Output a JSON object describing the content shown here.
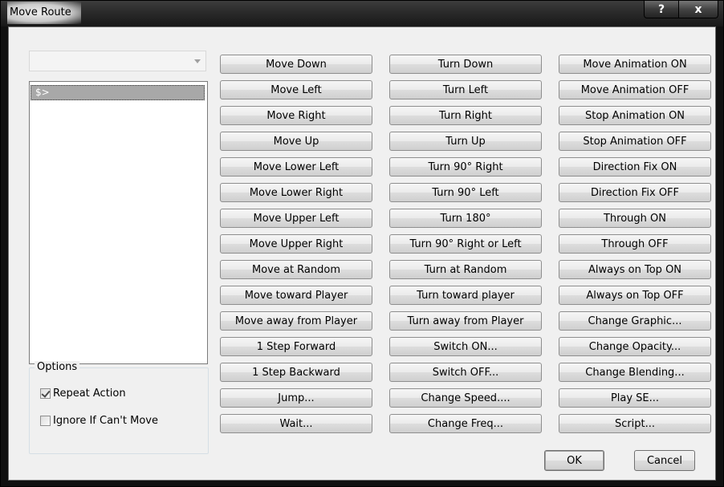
{
  "window": {
    "title": "Move Route",
    "help_label": "?",
    "close_label": "x"
  },
  "route_combo": {
    "selected": ""
  },
  "command_list": {
    "items": [
      "$>"
    ]
  },
  "options": {
    "legend": "Options",
    "repeat_action": {
      "label": "Repeat Action",
      "checked": true
    },
    "ignore_if_cant_move": {
      "label": "Ignore If Can't Move",
      "checked": false
    }
  },
  "columns": [
    {
      "buttons": [
        "Move Down",
        "Move Left",
        "Move Right",
        "Move Up",
        "Move Lower Left",
        "Move Lower Right",
        "Move Upper Left",
        "Move Upper Right",
        "Move at Random",
        "Move toward Player",
        "Move away from Player",
        "1 Step Forward",
        "1 Step Backward",
        "Jump...",
        "Wait..."
      ]
    },
    {
      "buttons": [
        "Turn Down",
        "Turn Left",
        "Turn Right",
        "Turn Up",
        "Turn 90° Right",
        "Turn 90° Left",
        "Turn 180°",
        "Turn 90° Right or Left",
        "Turn at Random",
        "Turn toward player",
        "Turn away from Player",
        "Switch ON...",
        "Switch OFF...",
        "Change Speed....",
        "Change Freq..."
      ]
    },
    {
      "buttons": [
        "Move Animation ON",
        "Move Animation OFF",
        "Stop Animation ON",
        "Stop Animation OFF",
        "Direction Fix ON",
        "Direction Fix OFF",
        "Through ON",
        "Through OFF",
        "Always on Top ON",
        "Always on Top OFF",
        "Change Graphic...",
        "Change Opacity...",
        "Change Blending...",
        "Play SE...",
        "Script..."
      ]
    }
  ],
  "dialog_buttons": {
    "ok": "OK",
    "cancel": "Cancel"
  }
}
